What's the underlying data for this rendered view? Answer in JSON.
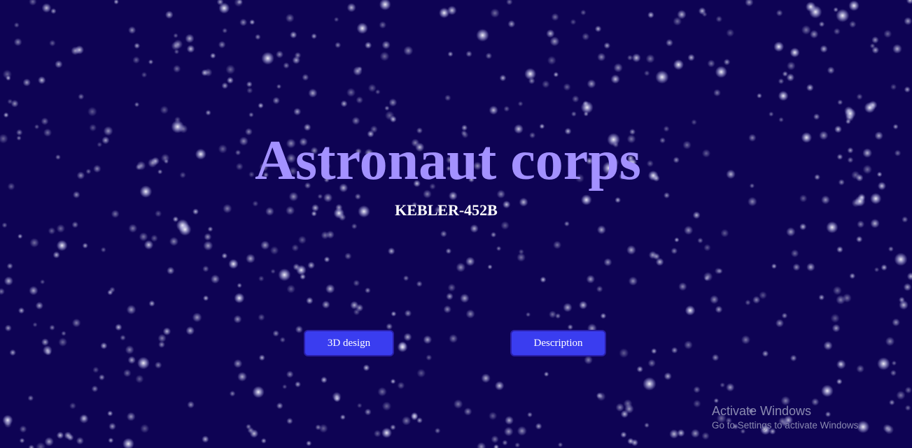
{
  "page": {
    "title": "Astronaut corps",
    "subtitle": "KEBLER-452B"
  },
  "buttons": {
    "design_label": "3D design",
    "description_label": "Description"
  },
  "watermark": {
    "title": "Activate Windows",
    "subtitle": "Go to Settings to activate Windows."
  },
  "colors": {
    "background": "#0e0354",
    "star": "#ffffff",
    "title": "#a391ff",
    "subtitle": "#ffffff",
    "button_fill": "#3a3df0",
    "button_border": "#2a1fa8"
  },
  "icons": {
    "background": "starfield"
  }
}
